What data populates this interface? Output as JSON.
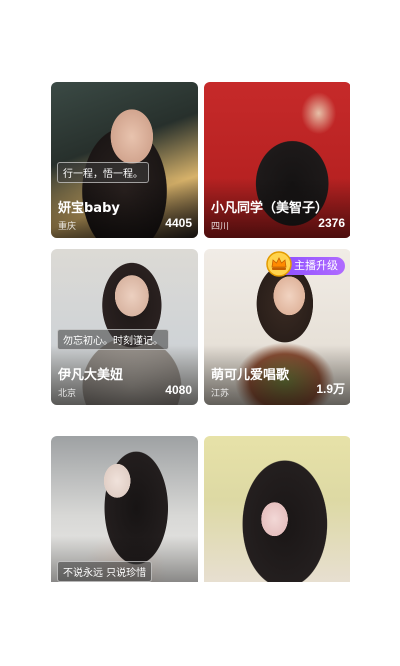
{
  "cards": [
    {
      "tagline": "行一程，悟一程。",
      "name": "妍宝baby",
      "city": "重庆",
      "count": "4405"
    },
    {
      "tagline": "",
      "name": "小凡同学（美智子）",
      "city": "四川",
      "count": "2376"
    },
    {
      "tagline": "勿忘初心。时刻谨记。",
      "name": "伊凡大美妞",
      "city": "北京",
      "count": "4080"
    },
    {
      "tagline": "",
      "name": "萌可儿爱唱歌",
      "city": "江苏",
      "count": "1.9万",
      "badge": "主播升级"
    },
    {
      "tagline": "不说永远 只说珍惜",
      "name": "",
      "city": "",
      "count": ""
    },
    {
      "tagline": "",
      "name": "",
      "city": "",
      "count": ""
    }
  ],
  "colors": {
    "badge_start": "#8a4dff",
    "badge_end": "#b06bff"
  },
  "icons": {
    "badge_icon": "crown-icon"
  }
}
